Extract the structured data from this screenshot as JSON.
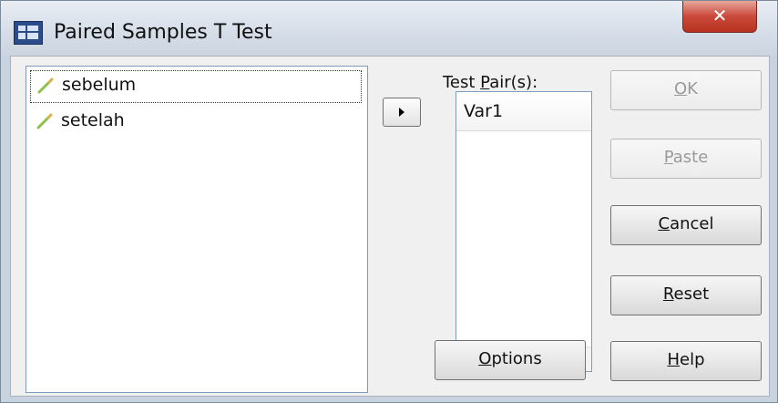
{
  "window": {
    "title": "Paired Samples T Test",
    "close_glyph": "✕"
  },
  "variables": [
    {
      "label": "sebelum",
      "icon": "scale-pencil-icon",
      "selected": true
    },
    {
      "label": "setelah",
      "icon": "scale-pencil-icon",
      "selected": false
    }
  ],
  "test_pairs": {
    "label_prefix": "Test ",
    "label_mnemonic": "P",
    "label_rest": "air(s):",
    "column_header": "Var1"
  },
  "buttons": {
    "ok": {
      "mnemonic": "O",
      "rest": "K",
      "enabled": false
    },
    "paste": {
      "mnemonic": "P",
      "rest": "aste",
      "enabled": false
    },
    "cancel": {
      "mnemonic": "C",
      "rest": "ancel",
      "enabled": true
    },
    "reset": {
      "mnemonic": "R",
      "rest": "eset",
      "enabled": true
    },
    "help": {
      "mnemonic": "H",
      "rest": "elp",
      "enabled": true
    },
    "options": {
      "mnemonic": "O",
      "rest": "ptions",
      "enabled": true
    }
  },
  "colors": {
    "pencil": "#8bc34a",
    "close": "#c9493a"
  }
}
